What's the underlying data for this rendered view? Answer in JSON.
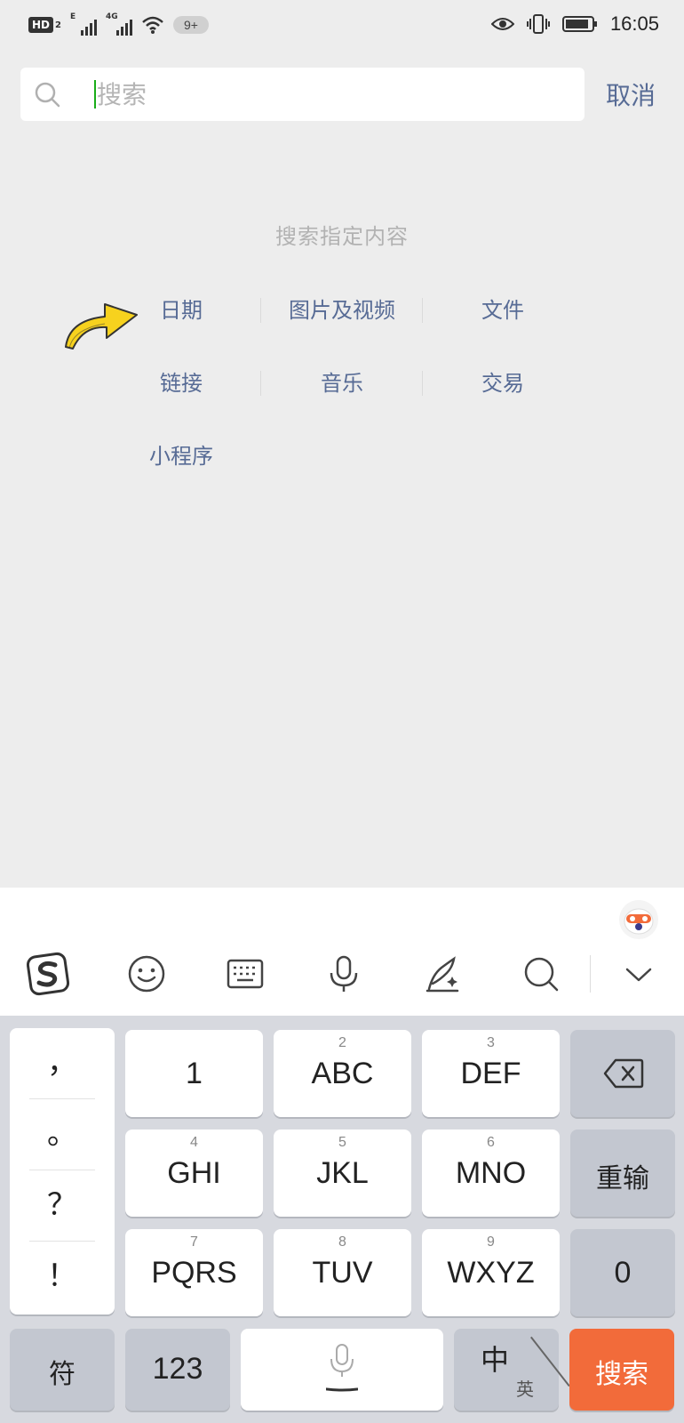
{
  "status_bar": {
    "hd": "HD",
    "hd_sub": "2",
    "sig1_tag": "E",
    "sig2_tag": "4G",
    "notifications": "9+",
    "time": "16:05"
  },
  "search": {
    "placeholder": "搜索",
    "cancel_label": "取消"
  },
  "content": {
    "hint": "搜索指定内容",
    "categories": [
      "日期",
      "图片及视频",
      "文件",
      "链接",
      "音乐",
      "交易",
      "小程序"
    ]
  },
  "keyboard": {
    "punctuation": [
      "，",
      "。",
      "？",
      "！"
    ],
    "rows": [
      [
        {
          "num": "",
          "label": "1"
        },
        {
          "num": "2",
          "label": "ABC"
        },
        {
          "num": "3",
          "label": "DEF"
        }
      ],
      [
        {
          "num": "4",
          "label": "GHI"
        },
        {
          "num": "5",
          "label": "JKL"
        },
        {
          "num": "6",
          "label": "MNO"
        }
      ],
      [
        {
          "num": "7",
          "label": "PQRS"
        },
        {
          "num": "8",
          "label": "TUV"
        },
        {
          "num": "9",
          "label": "WXYZ"
        }
      ]
    ],
    "reenter_label": "重输",
    "zero_label": "0",
    "symbol_label": "符",
    "num_label": "123",
    "lang_main": "中",
    "lang_alt": "英",
    "search_label": "搜索"
  },
  "colors": {
    "link": "#576b95",
    "search_key": "#f26b3a",
    "caret": "#1aad19"
  }
}
